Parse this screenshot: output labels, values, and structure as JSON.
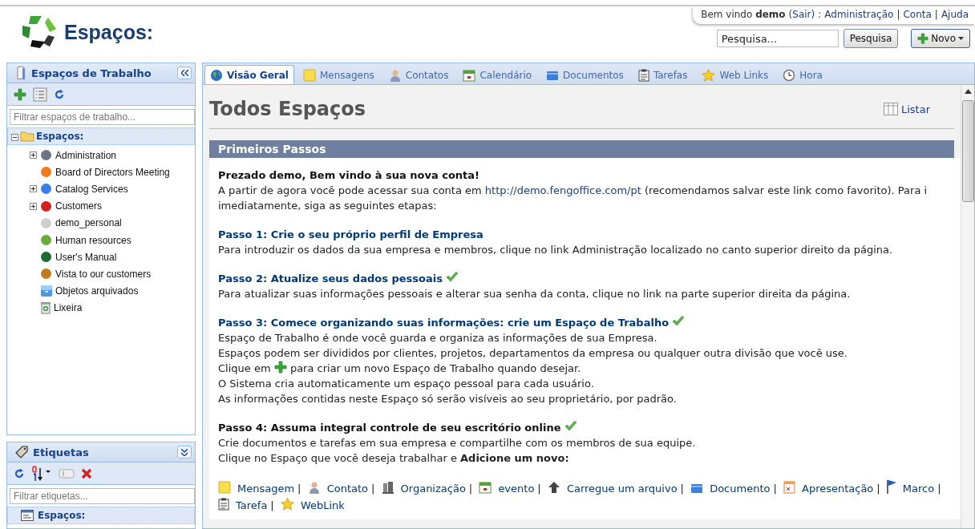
{
  "header": {
    "title": "Espaços:",
    "user_bar": {
      "greeting": "Bem vindo **demo**",
      "links": [
        {
          "label": "(Sair)",
          "sep": ":"
        },
        {
          "label": "Administração",
          "sep": "|"
        },
        {
          "label": "Conta",
          "sep": "|"
        },
        {
          "label": "Ajuda"
        }
      ]
    },
    "search": {
      "value": "Pesquisa...",
      "button": "Pesquisa"
    },
    "new_button": "Novo"
  },
  "sidebar": {
    "workspaces": {
      "title": "Espaços de Trabalho",
      "filter_placeholder": "Filtrar espaços de trabalho...",
      "root": {
        "label": "Espaços:",
        "expanded": true,
        "children": [
          {
            "label": "Administration",
            "kind": "workspace",
            "color": "#6b7585",
            "has_children": true
          },
          {
            "label": "Board of Directors Meeting",
            "kind": "workspace",
            "color": "#f07a1e",
            "has_children": false
          },
          {
            "label": "Catalog Services",
            "kind": "workspace",
            "color": "#3a7ee8",
            "has_children": true
          },
          {
            "label": "Customers",
            "kind": "workspace",
            "color": "#d61f1f",
            "has_children": true
          },
          {
            "label": "demo_personal",
            "kind": "workspace",
            "color": "#cfcfcf",
            "has_children": false
          },
          {
            "label": "Human resources",
            "kind": "workspace",
            "color": "#6aaa3c",
            "has_children": false
          },
          {
            "label": "User's Manual",
            "kind": "workspace",
            "color": "#1e6b32",
            "has_children": false
          },
          {
            "label": "Vista to our customers",
            "kind": "workspace",
            "color": "#c07a1e",
            "has_children": false
          },
          {
            "label": "Objetos arquivados",
            "kind": "archive",
            "has_children": false
          },
          {
            "label": "Lixeira",
            "kind": "trash",
            "has_children": false
          }
        ]
      }
    },
    "tags": {
      "title": "Etiquetas",
      "filter_placeholder": "Filtrar etiquetas...",
      "root": "Espaços:"
    }
  },
  "tabs": [
    {
      "label": "Visão Geral",
      "kind": "globe",
      "selected": true
    },
    {
      "label": "Mensagens",
      "kind": "note",
      "selected": false
    },
    {
      "label": "Contatos",
      "kind": "person",
      "selected": false
    },
    {
      "label": "Calendário",
      "kind": "calendar",
      "selected": false
    },
    {
      "label": "Documentos",
      "kind": "folder",
      "selected": false
    },
    {
      "label": "Tarefas",
      "kind": "tasks",
      "selected": false
    },
    {
      "label": "Web Links",
      "kind": "star",
      "selected": false
    },
    {
      "label": "Hora",
      "kind": "clock",
      "selected": false
    }
  ],
  "main": {
    "title": "Todos Espaços",
    "list_button": "Listar",
    "section": "Primeiros Passos",
    "intro": {
      "heading": "Prezado demo, Bem vindo à sua nova conta!",
      "lines": [
        {
          "kind": "link_line",
          "before": "A partir de agora você pode acessar sua conta em",
          "link": "http://demo.fengoffice.com/pt",
          "after": "(recomendamos salvar este link como favorito). Para i"
        },
        {
          "kind": "text",
          "text": "imediatamente, siga as seguintes etapas:"
        }
      ]
    },
    "steps": [
      {
        "title": "Passo 1: Crie o seu próprio perfil de Empresa",
        "linked": true,
        "done": false,
        "lines": [
          {
            "kind": "text",
            "text": "Para introduzir os dados da sua empresa e membros, clique no link Administração localizado no canto superior direito da página."
          }
        ]
      },
      {
        "title": "Passo 2: Atualize seus dados pessoais",
        "linked": true,
        "done": true,
        "lines": [
          {
            "kind": "text",
            "text": "Para atualizar suas informações pessoais e alterar sua senha da conta, clique no link na parte superior direita da página."
          }
        ]
      },
      {
        "title": "Passo 3: Comece organizando suas informações: crie um Espaço de Trabalho",
        "linked": true,
        "done": true,
        "lines": [
          {
            "kind": "text",
            "text": "Espaço de Trabalho é onde você guarda e organiza as informações de sua Empresa."
          },
          {
            "kind": "text",
            "text": "Espaços podem ser divididos por clientes, projetos, departamentos da empresa ou qualquer outra divisão que você use."
          },
          {
            "kind": "plus_line",
            "before": "Clique em",
            "after": "para criar um novo Espaço de Trabalho quando desejar."
          },
          {
            "kind": "text",
            "text": "O Sistema cria automaticamente um espaço pessoal para cada usuário."
          },
          {
            "kind": "text",
            "text": "As informações contidas neste Espaço só serão visíveis ao seu proprietário, por padrão."
          }
        ]
      },
      {
        "title": "Passo 4: Assuma integral controle de seu escritório online",
        "linked": false,
        "done": true,
        "lines": [
          {
            "kind": "text",
            "text": "Crie documentos e tarefas em sua empresa e compartilhe com os membros de sua equipe."
          },
          {
            "kind": "text",
            "text": "Clique no Espaço que você deseja trabalhar e **Adicione um novo:**"
          }
        ]
      }
    ],
    "quick_links": [
      {
        "label": "Mensagem",
        "kind": "note",
        "sep": "|"
      },
      {
        "label": "Contato",
        "kind": "person",
        "sep": "|"
      },
      {
        "label": "Organização",
        "kind": "building",
        "sep": "|"
      },
      {
        "label": "evento",
        "kind": "calendar",
        "sep": "|"
      },
      {
        "label": "Carregue um arquivo",
        "kind": "upload",
        "sep": "|"
      },
      {
        "label": "Documento",
        "kind": "folder",
        "sep": "|"
      },
      {
        "label": "Apresentação",
        "kind": "presentation",
        "sep": "|"
      },
      {
        "label": "Marco",
        "kind": "flag",
        "sep": "|"
      },
      {
        "label": "Tarefa",
        "kind": "tasks",
        "sep": "|"
      },
      {
        "label": "WebLink",
        "kind": "star"
      }
    ]
  }
}
